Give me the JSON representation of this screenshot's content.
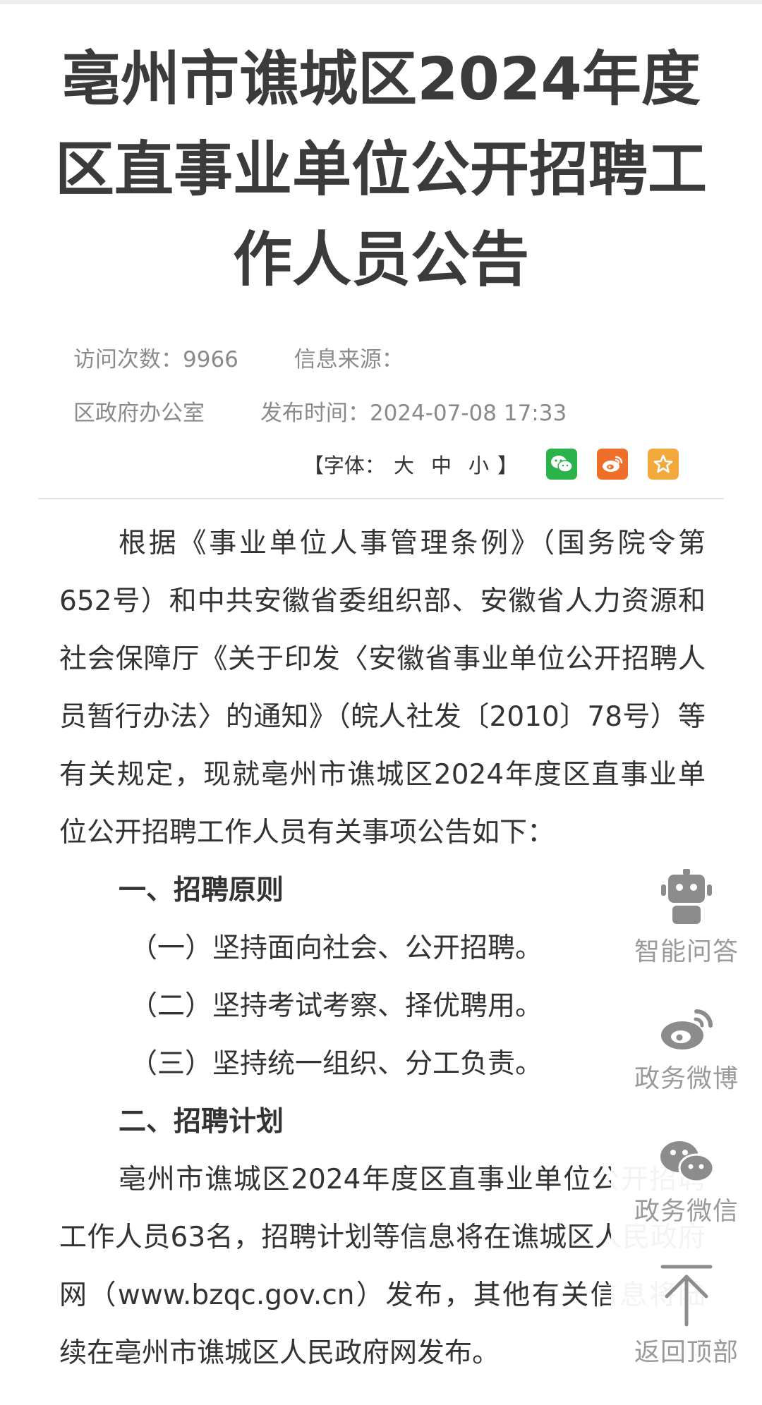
{
  "article": {
    "title": "亳州市谯城区2024年度区直事业单位公开招聘工作人员公告",
    "meta": {
      "visits_label": "访问次数：",
      "visits_value": "9966",
      "source_label": "信息来源：",
      "source_value": "区政府办公室",
      "publish_label": "发布时间：",
      "publish_value": "2024-07-08 17:33"
    }
  },
  "toolbar": {
    "font_label": "【字体：",
    "font_large": "大",
    "font_medium": "中",
    "font_small": "小",
    "font_close": "】"
  },
  "content": {
    "intro": "根据《事业单位人事管理条例》（国务院令第652号）和中共安徽省委组织部、安徽省人力资源和社会保障厅《关于印发〈安徽省事业单位公开招聘人员暂行办法〉的通知》（皖人社发〔2010〕78号）等有关规定，现就亳州市谯城区2024年度区直事业单位公开招聘工作人员有关事项公告如下：",
    "section1_heading": "一、招聘原则",
    "section1_items": [
      "（一）坚持面向社会、公开招聘。",
      "（二）坚持考试考察、择优聘用。",
      "（三）坚持统一组织、分工负责。"
    ],
    "section2_heading": "二、招聘计划",
    "section2_text": "亳州市谯城区2024年度区直事业单位公开招聘工作人员63名，招聘计划等信息将在谯城区人民政府网（www.bzqc.gov.cn）发布，其他有关信息将陆续在亳州市谯城区人民政府网发布。"
  },
  "float_menu": {
    "qa": "智能问答",
    "weibo": "政务微博",
    "wechat": "政务微信",
    "top": "返回顶部"
  },
  "colors": {
    "wechat": "#29b34a",
    "weibo": "#ef6f2a",
    "favorite": "#f2a83a",
    "float_icon": "#8c8c8c"
  },
  "icons": {
    "share_wechat": "wechat-icon",
    "share_weibo": "weibo-icon",
    "share_favorite": "star-icon",
    "float_qa": "robot-icon",
    "float_weibo": "weibo-icon",
    "float_wechat": "wechat-icon",
    "float_top": "arrow-up-icon"
  }
}
